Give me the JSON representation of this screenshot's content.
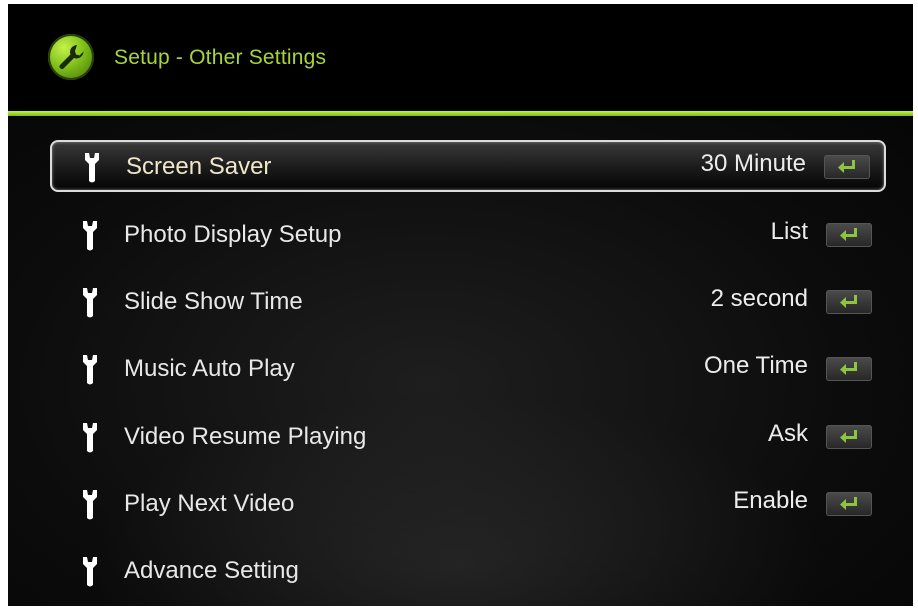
{
  "header": {
    "title": "Setup - Other Settings",
    "icon": "wrench-icon",
    "accent_color": "#8cc63f"
  },
  "menu": {
    "items": [
      {
        "label": "Screen Saver",
        "value": "30 Minute",
        "selected": true,
        "icon": "wrench-icon",
        "action_icon": "enter-icon"
      },
      {
        "label": "Photo Display Setup",
        "value": "List",
        "selected": false,
        "icon": "wrench-icon",
        "action_icon": "enter-icon"
      },
      {
        "label": "Slide Show Time",
        "value": "2 second",
        "selected": false,
        "icon": "wrench-icon",
        "action_icon": "enter-icon"
      },
      {
        "label": "Music Auto Play",
        "value": "One Time",
        "selected": false,
        "icon": "wrench-icon",
        "action_icon": "enter-icon"
      },
      {
        "label": "Video Resume Playing",
        "value": "Ask",
        "selected": false,
        "icon": "wrench-icon",
        "action_icon": "enter-icon"
      },
      {
        "label": "Play Next Video",
        "value": "Enable",
        "selected": false,
        "icon": "wrench-icon",
        "action_icon": "enter-icon"
      },
      {
        "label": "Advance Setting",
        "value": "",
        "selected": false,
        "icon": "wrench-icon",
        "action_icon": ""
      }
    ]
  }
}
